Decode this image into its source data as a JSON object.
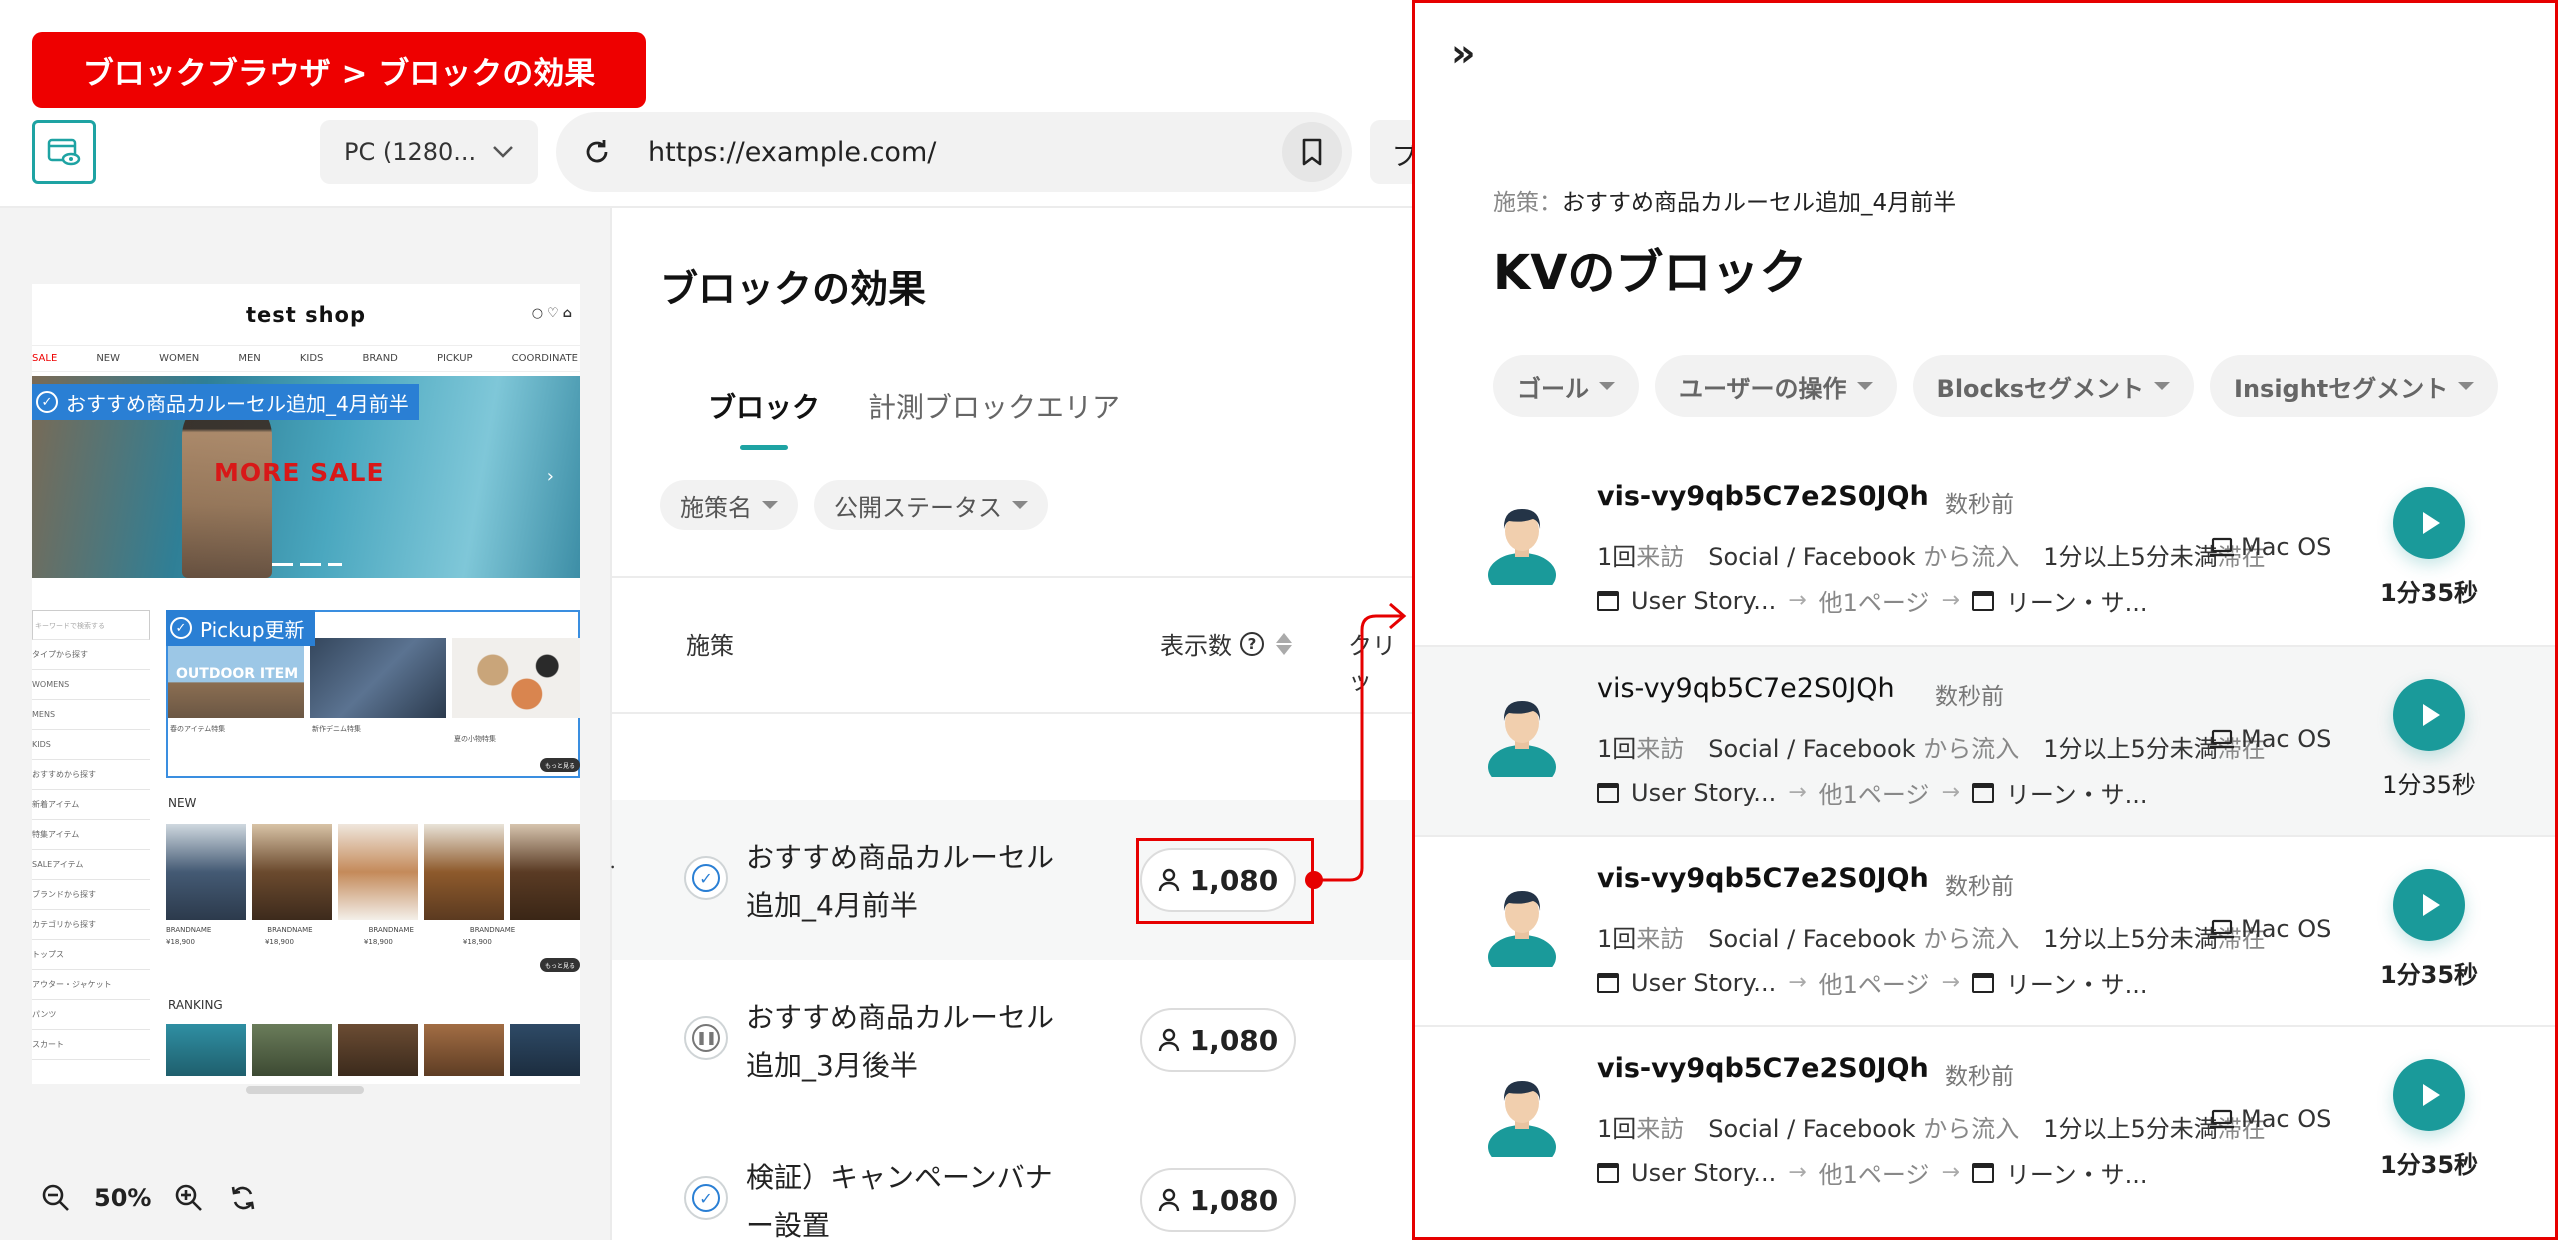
{
  "banner": {
    "title": "ブロックブラウザ > ブロックの効果"
  },
  "toolbar": {
    "device": "PC (1280...",
    "url": "https://example.com/",
    "extra_label": "プ"
  },
  "preview": {
    "shop_name": "test shop",
    "nav": [
      "SALE",
      "NEW",
      "WOMEN",
      "MEN",
      "KIDS",
      "BRAND",
      "PICKUP",
      "COORDINATE"
    ],
    "hero_text": "MORE SALE",
    "kv_block_tag": "おすすめ商品カルーセル追加_4月前半",
    "pickup_tag": "Pickup更新",
    "outdoor_label": "OUTDOOR ITEM",
    "search_placeholder": "キーワードで検索する",
    "side_menu": [
      "タイプから探す",
      "WOMENS",
      "MENS",
      "KIDS",
      "おすすめから探す",
      "新着アイテム",
      "特集アイテム",
      "SALEアイテム",
      "ブランドから探す",
      "カテゴリから探す",
      "トップス",
      "アウター・ジャケット",
      "パンツ",
      "スカート"
    ],
    "pickup_captions": [
      "春のアイテム特集",
      "新作デニム特集",
      "夏の小物特集"
    ],
    "new_label": "NEW",
    "ranking_label": "RANKING",
    "brand_caption": "BRANDNAME",
    "price_caption": "¥18,900",
    "more_label": "もっと見る"
  },
  "zoom": {
    "level": "50%"
  },
  "main": {
    "title": "ブロックの効果",
    "tabs": [
      {
        "label": "ブロック",
        "active": true
      },
      {
        "label": "計測ブロックエリア",
        "active": false
      }
    ],
    "filters": [
      "施策名",
      "公開ステータス"
    ],
    "columns": {
      "campaign": "施策",
      "views": "表示数",
      "clicks": "クリッ"
    },
    "rows": [
      {
        "name": "おすすめ商品カルーセル追加_4月前半",
        "status": "published",
        "views": "1,080",
        "highlighted": true
      },
      {
        "name": "おすすめ商品カルーセル追加_3月後半",
        "status": "paused",
        "views": "1,080",
        "highlighted": false
      },
      {
        "name": "検証）キャンペーンバナー設置",
        "status": "published",
        "views": "1,080",
        "highlighted": false
      }
    ]
  },
  "panel": {
    "breadcrumb_label": "施策：",
    "breadcrumb_value": "おすすめ商品カルーセル追加_4月前半",
    "title": "KVのブロック",
    "filters": [
      "ゴール",
      "ユーザーの操作",
      "Blocksセグメント",
      "Insightセグメント"
    ],
    "visits": [
      {
        "id": "vis-vy9qb5C7e2S0JQh",
        "time": "数秒前",
        "count": "1回",
        "count_suffix": "来訪",
        "source": "Social / Facebook",
        "source_suffix": "から流入",
        "stay": "1分以上5分未満",
        "stay_suffix": "滞在",
        "os": "Mac OS",
        "page1": "User Story...",
        "middle": "他1ページ",
        "page2": "リーン・サ...",
        "duration": "1分35秒",
        "bold": true,
        "highlighted": false
      },
      {
        "id": "vis-vy9qb5C7e2S0JQh",
        "time": "数秒前",
        "count": "1回",
        "count_suffix": "来訪",
        "source": "Social / Facebook",
        "source_suffix": "から流入",
        "stay": "1分以上5分未満",
        "stay_suffix": "滞在",
        "os": "Mac OS",
        "page1": "User Story...",
        "middle": "他1ページ",
        "page2": "リーン・サ...",
        "duration": "1分35秒",
        "bold": false,
        "highlighted": true
      },
      {
        "id": "vis-vy9qb5C7e2S0JQh",
        "time": "数秒前",
        "count": "1回",
        "count_suffix": "来訪",
        "source": "Social / Facebook",
        "source_suffix": "から流入",
        "stay": "1分以上5分未満",
        "stay_suffix": "滞在",
        "os": "Mac OS",
        "page1": "User Story...",
        "middle": "他1ページ",
        "page2": "リーン・サ...",
        "duration": "1分35秒",
        "bold": true,
        "highlighted": false
      },
      {
        "id": "vis-vy9qb5C7e2S0JQh",
        "time": "数秒前",
        "count": "1回",
        "count_suffix": "来訪",
        "source": "Social / Facebook",
        "source_suffix": "から流入",
        "stay": "1分以上5分未満",
        "stay_suffix": "滞在",
        "os": "Mac OS",
        "page1": "User Story...",
        "middle": "他1ページ",
        "page2": "リーン・サ...",
        "duration": "1分35秒",
        "bold": true,
        "highlighted": false
      }
    ]
  },
  "colors": {
    "accent": "#1ea3a3",
    "play": "#1a9a9a",
    "highlight_red": "#e60000",
    "block_tag": "#2a7fd4"
  }
}
